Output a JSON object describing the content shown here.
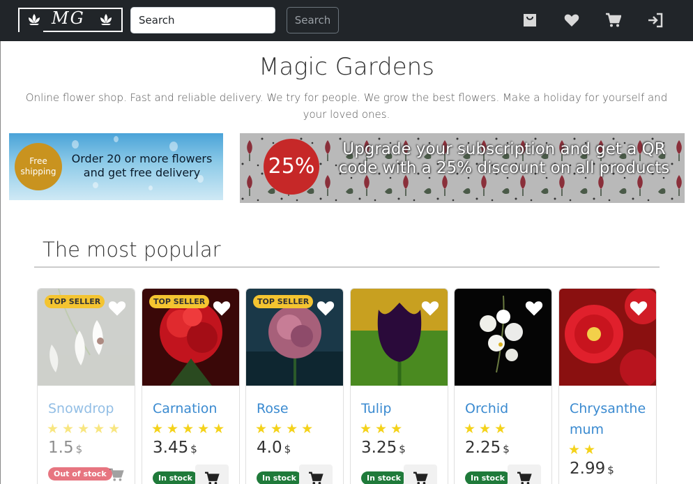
{
  "navbar": {
    "logo_text": "MG",
    "search_placeholder": "Search",
    "search_button": "Search"
  },
  "hero": {
    "title": "Magic Gardens",
    "subtitle": "Online flower shop. Fast and reliable delivery. We try for people. We grow the best flowers. Make a holiday for yourself and your loved ones."
  },
  "banners": {
    "free_shipping_badge": "Free shipping",
    "free_shipping_text": "Order 20 or more flowers and get free delivery",
    "discount_badge": "25%",
    "discount_text": "Upgrade your subscription and get a QR code with a 25% discount on all products"
  },
  "section": {
    "title": "The most popular"
  },
  "products": [
    {
      "name": "Snowdrop",
      "rating": 5,
      "price": "1.5",
      "currency": "$",
      "stock": "Out of stock",
      "top_seller": "TOP SELLER"
    },
    {
      "name": "Carnation",
      "rating": 5,
      "price": "3.45",
      "currency": "$",
      "stock": "In stock",
      "top_seller": "TOP SELLER"
    },
    {
      "name": "Rose",
      "rating": 4,
      "price": "4.0",
      "currency": "$",
      "stock": "In stock",
      "top_seller": "TOP SELLER"
    },
    {
      "name": "Tulip",
      "rating": 3,
      "price": "3.25",
      "currency": "$",
      "stock": "In stock",
      "top_seller": ""
    },
    {
      "name": "Orchid",
      "rating": 3,
      "price": "2.25",
      "currency": "$",
      "stock": "In stock",
      "top_seller": ""
    },
    {
      "name": "Chrysanthe mum",
      "rating": 2,
      "price": "2.99",
      "currency": "$",
      "stock": "",
      "top_seller": ""
    }
  ],
  "icons": {
    "nav": [
      "shopping-bag-icon",
      "heart-icon",
      "cart-icon",
      "login-icon"
    ]
  },
  "colors": {
    "navbar_bg": "#212529",
    "link_blue": "#3a8ad0",
    "star_yellow": "#f4d21a",
    "in_stock_green": "#1f7a3a",
    "out_of_stock_red": "#e35d6a",
    "top_seller_yellow": "#f4c430"
  }
}
